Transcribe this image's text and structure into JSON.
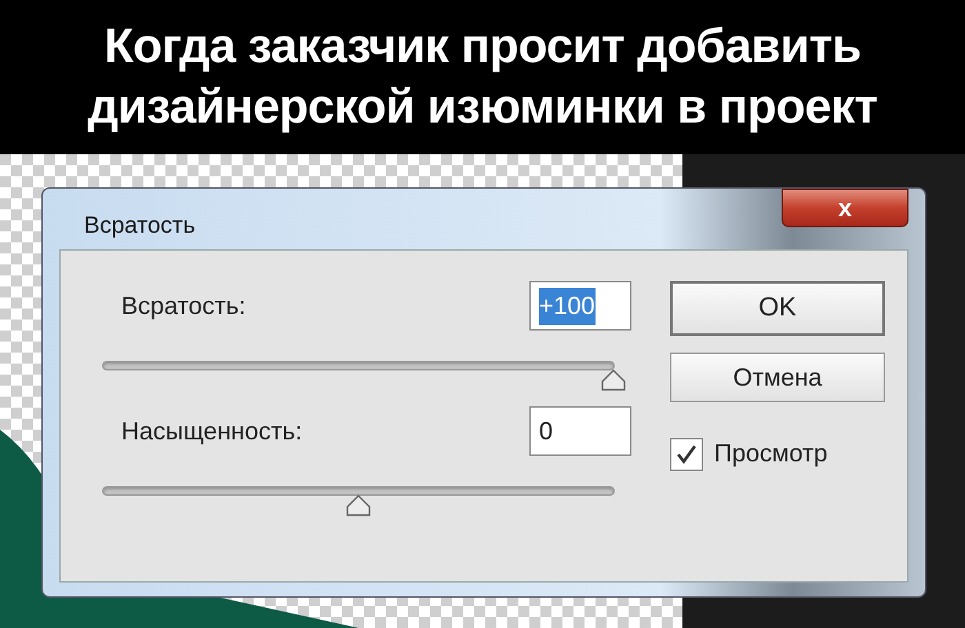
{
  "caption": [
    "Когда заказчик просит добавить",
    "дизайнерской изюминки в проект"
  ],
  "window": {
    "title": "Всратость",
    "close_label": "x"
  },
  "controls": [
    {
      "label": "Всратость:",
      "value": "+100",
      "text_selected": true,
      "level": 1
    },
    {
      "label": "Насыщенность:",
      "value": "0",
      "text_selected": false,
      "level": 0.5
    }
  ],
  "buttons": [
    "OK",
    "Отмена"
  ],
  "preview": {
    "label": "Просмотр",
    "checked": true
  }
}
